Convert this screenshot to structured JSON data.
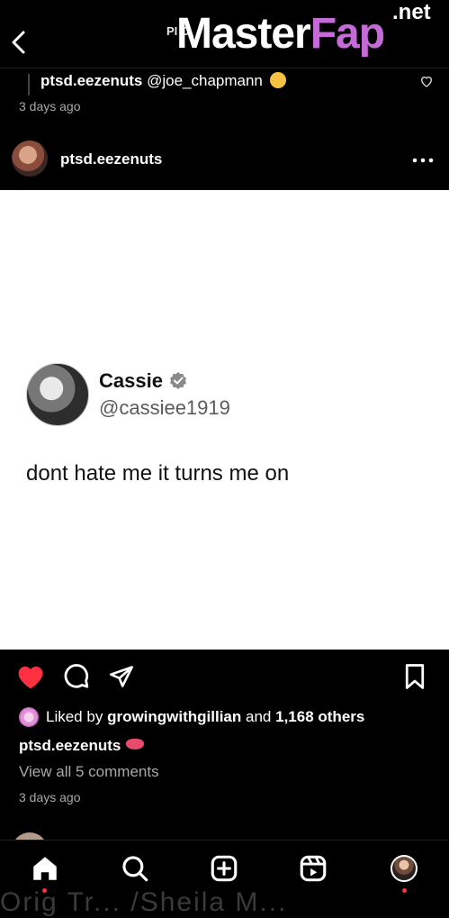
{
  "top": {
    "back_label": "Back",
    "title_fragment": "PI C",
    "watermark_main": "Master",
    "watermark_accent": "Fap",
    "watermark_tld": ".net"
  },
  "comment": {
    "user": "ptsd.eezenuts",
    "mention": "@joe_chapmann",
    "time": "3 days ago"
  },
  "post": {
    "user": "ptsd.eezenuts",
    "tweet": {
      "name": "Cassie",
      "handle": "@cassiee1919",
      "text": "dont hate me it turns me on"
    },
    "liked_prefix": "Liked by",
    "liked_user": "growingwithgillian",
    "liked_and": "and",
    "liked_others": "1,168 others",
    "caption_user": "ptsd.eezenuts",
    "view_comments": "View all 5 comments",
    "time": "3 days ago"
  },
  "colors": {
    "like_red": "#ff3040",
    "background": "#000000",
    "secondary_text": "#a8a8a8"
  },
  "icons": [
    "chevron-left-icon",
    "heart-outline-icon",
    "more-dots-icon",
    "heart-filled-icon",
    "comment-icon",
    "share-icon",
    "bookmark-icon",
    "home-icon",
    "search-icon",
    "create-icon",
    "reels-icon",
    "profile-avatar"
  ],
  "bottom_bleed_text": "Orig Tr... /Sheila M... ",
  "nav": [
    "Home",
    "Search",
    "Create",
    "Reels",
    "Profile"
  ]
}
